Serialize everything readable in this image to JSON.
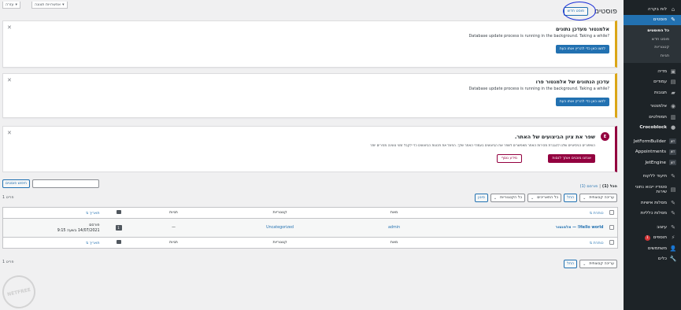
{
  "sidebar": {
    "items": [
      {
        "label": "לוח בקרה",
        "icon": "dashboard-icon"
      },
      {
        "label": "פוסטים",
        "icon": "pushpin-icon",
        "active": true
      },
      {
        "label": "מדיה",
        "icon": "media-icon"
      },
      {
        "label": "עמודים",
        "icon": "page-icon"
      },
      {
        "label": "תגובות",
        "icon": "comments-icon"
      },
      {
        "label": "אלמנטור",
        "icon": "elementor-icon"
      },
      {
        "label": "תמפלטים",
        "icon": "templates-icon"
      },
      {
        "label": "Crocoblock",
        "icon": "crocoblock-icon"
      },
      {
        "label": "JetFormBuilder",
        "icon": "jet-icon"
      },
      {
        "label": "Appointments",
        "icon": "jet-icon"
      },
      {
        "label": "JetEngine",
        "icon": "jet-icon"
      },
      {
        "label": "תיעוד ללקוח",
        "icon": "docs-icon"
      },
      {
        "label": "סטודיו ייבוא נתוני שירות",
        "icon": "import-icon"
      },
      {
        "label": "מסלות אישיות",
        "icon": "personal-icon"
      },
      {
        "label": "מסלות כלליות",
        "icon": "general-icon"
      },
      {
        "label": "עיצוב",
        "icon": "brush-icon"
      },
      {
        "label": "תוספים",
        "icon": "plugins-icon",
        "badge": "1"
      },
      {
        "label": "משתמשים",
        "icon": "users-icon"
      },
      {
        "label": "כלים",
        "icon": "tools-icon"
      }
    ],
    "posts_submenu": [
      "כל הפוסטים",
      "פוסט חדש",
      "קטגוריות",
      "תגיות"
    ]
  },
  "header": {
    "screen_options": "אפשרויות תצוגה",
    "help": "עזרה",
    "page_title": "פוסטים",
    "add_new": "פוסט חדש"
  },
  "notices": [
    {
      "title": "אלמנטור מעדכן נתונים",
      "text": "Database update process is running in the background. Taking a while?",
      "button": "לחצו כאן כדי להריץ אותו כעת"
    },
    {
      "title": "עדכון הנתונים של אלמנטור פרו",
      "text": "Database update process is running in the background. Taking a while?",
      "button": "לחצו כאן כדי להריץ אותו כעת"
    }
  ],
  "elementor_notice": {
    "logo": "E",
    "title": "שפר את ציון הביצועים של האתר.",
    "text": "השיפורים הניסיוניים שלנו להגברת מהירות האתר מאפשרים לשפר את הביצועים בעמודי האתר שלך. הפעל את תכונות הביצועים כדי לקבל זמני טעינה מהירים יותר",
    "btn_primary": "אנחנו מוכנים אותך לנסות",
    "btn_secondary": "מידע נוסף"
  },
  "search": {
    "button": "חיפוש פוסטים"
  },
  "subsubsub": {
    "all": "הכל (1)",
    "sep": "|",
    "published": "פורסם (1)"
  },
  "tablenav": {
    "bulk": "עריכה קבוצתית",
    "apply": "החל",
    "dates": "כל התאריכים",
    "categories": "כל הקטגוריות",
    "filter": "סינון",
    "count": "פריט 1"
  },
  "table": {
    "columns": {
      "title": "כותרת",
      "author": "מאת",
      "categories": "קטגוריות",
      "tags": "תגיות",
      "date": "תאריך"
    },
    "rows": [
      {
        "title": "Hello world! — אלמנטור",
        "author": "admin",
        "categories": "Uncategorized",
        "tags": "—",
        "comments": "1",
        "status": "פורסם",
        "date": "14/07/2021 בשעה 9:15"
      }
    ]
  },
  "watermark": "NETFREE"
}
